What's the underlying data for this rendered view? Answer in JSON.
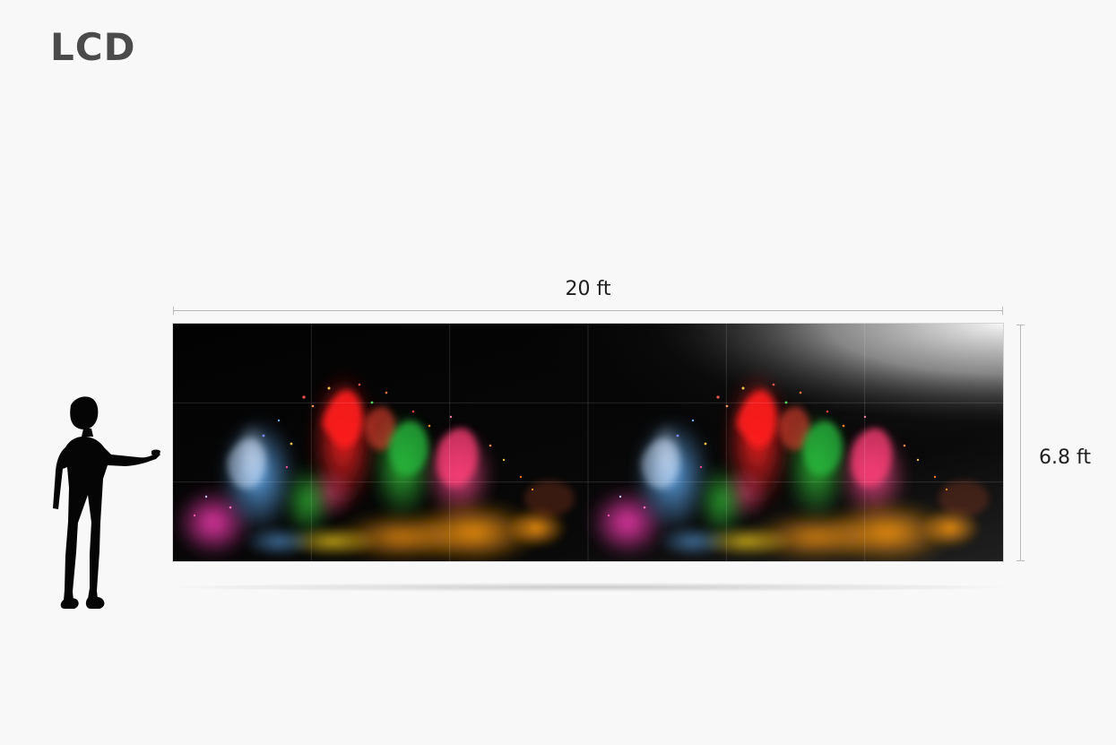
{
  "page": {
    "title": "LCD",
    "width_label": "20 ft",
    "height_label": "6.8 ft"
  },
  "icons": {
    "person": "person-silhouette-icon",
    "screen": "lcd-video-wall-icon"
  },
  "colors": {
    "title": "#4b4b4b",
    "label": "#1f1f1f",
    "dimension": "#b8b8b8",
    "wall": "#050505",
    "background": "#f8f8f8"
  }
}
